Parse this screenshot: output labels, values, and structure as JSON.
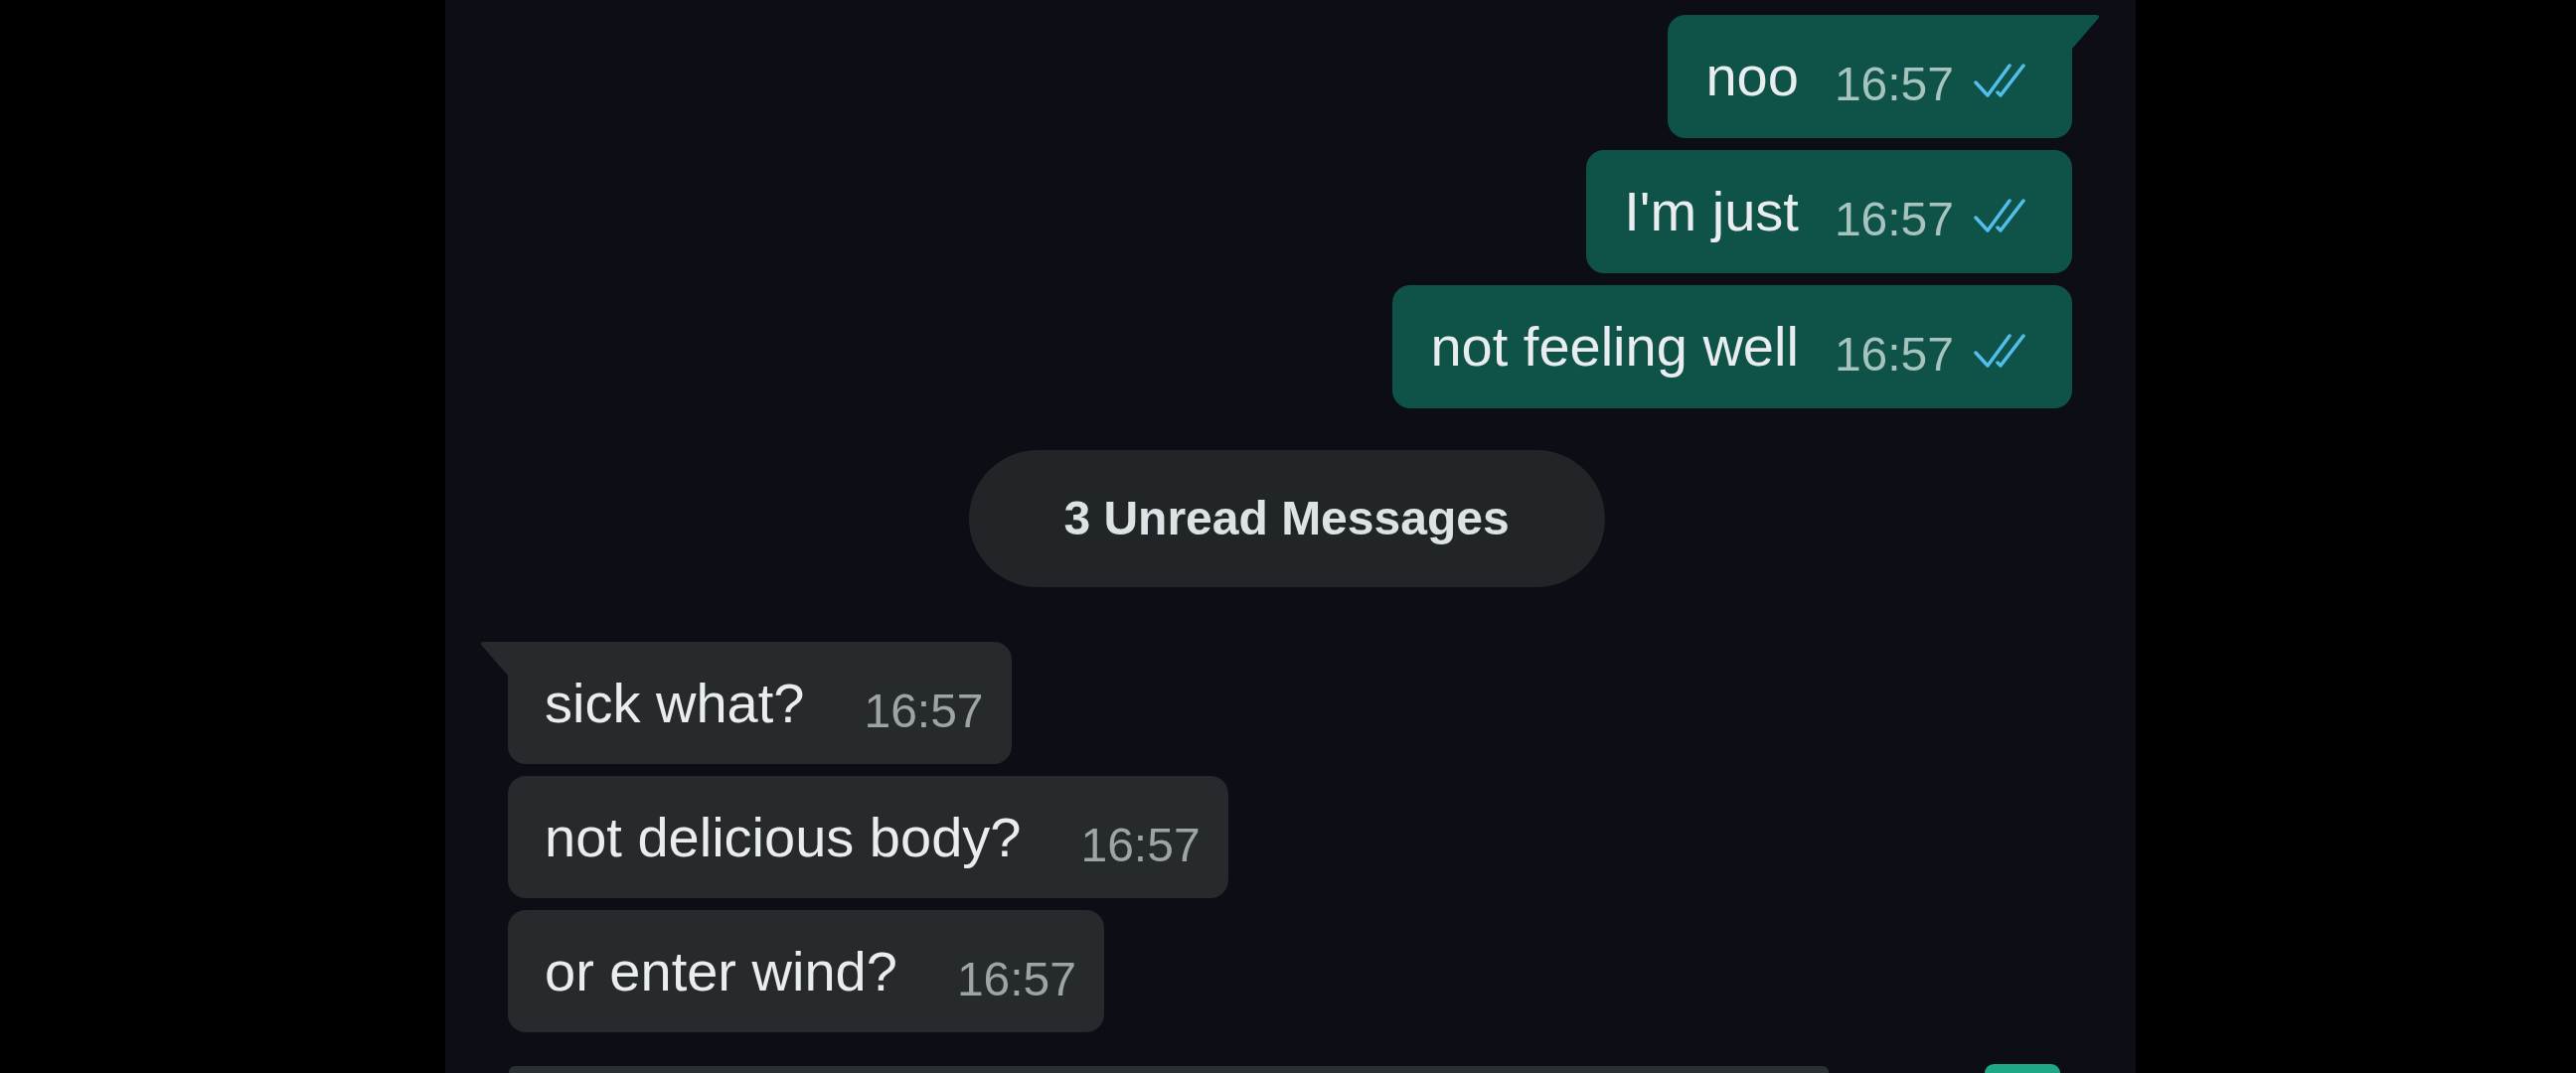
{
  "chat": {
    "messages": [
      {
        "kind": "outgoing",
        "text": "noo",
        "time": "16:57",
        "read": true,
        "tail": true
      },
      {
        "kind": "outgoing",
        "text": "I'm just",
        "time": "16:57",
        "read": true,
        "tail": false
      },
      {
        "kind": "outgoing",
        "text": "not feeling well",
        "time": "16:57",
        "read": true,
        "tail": false
      },
      {
        "kind": "unread_divider",
        "text": "3 Unread Messages"
      },
      {
        "kind": "incoming",
        "text": "sick what?",
        "time": "16:57",
        "tail": true
      },
      {
        "kind": "incoming",
        "text": "not delicious body?",
        "time": "16:57",
        "tail": false
      },
      {
        "kind": "incoming",
        "text": "or enter wind?",
        "time": "16:57",
        "tail": false
      }
    ]
  }
}
